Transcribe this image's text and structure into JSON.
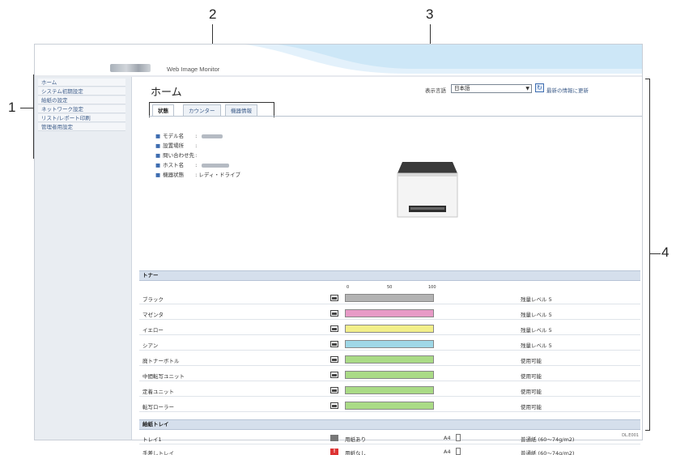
{
  "callouts": [
    "1",
    "2",
    "3",
    "4"
  ],
  "header": {
    "app_title": "Web Image Monitor"
  },
  "sidebar": {
    "items": [
      {
        "label": "ホーム"
      },
      {
        "label": "システム初期設定"
      },
      {
        "label": "給紙の設定"
      },
      {
        "label": "ネットワーク設定"
      },
      {
        "label": "リスト/レポート印刷"
      },
      {
        "label": "管理者用設定"
      }
    ]
  },
  "main": {
    "title": "ホーム",
    "language": {
      "label": "表示言語",
      "value": "日本語"
    },
    "refresh_label": "最新の情報に更新",
    "tabs": [
      {
        "label": "状態",
        "active": true
      },
      {
        "label": "カウンター",
        "active": false
      },
      {
        "label": "機器情報",
        "active": false
      }
    ],
    "info": [
      {
        "label": "モデル名",
        "value": ":"
      },
      {
        "label": "設置場所",
        "value": ":"
      },
      {
        "label": "問い合わせ先",
        "value": ":"
      },
      {
        "label": "ホスト名",
        "value": ":"
      },
      {
        "label": "機器状態",
        "value": ": レディ・ドライブ"
      }
    ]
  },
  "toner": {
    "section_label": "トナー",
    "scale": [
      "0",
      "50",
      "100"
    ],
    "rows": [
      {
        "name": "ブラック",
        "level": 1.0,
        "color": "#b3b3b3",
        "status": "残量レベル 5"
      },
      {
        "name": "マゼンタ",
        "level": 1.0,
        "color": "#e79ac6",
        "status": "残量レベル 5"
      },
      {
        "name": "イエロー",
        "level": 1.0,
        "color": "#f2ef8a",
        "status": "残量レベル 5"
      },
      {
        "name": "シアン",
        "level": 1.0,
        "color": "#9fd8e7",
        "status": "残量レベル 5"
      },
      {
        "name": "廃トナーボトル",
        "level": 1.0,
        "color": "#aadb86",
        "status": "使用可能"
      },
      {
        "name": "中間転写ユニット",
        "level": 1.0,
        "color": "#aadb86",
        "status": "使用可能"
      },
      {
        "name": "定着ユニット",
        "level": 1.0,
        "color": "#aadb86",
        "status": "使用可能"
      },
      {
        "name": "転写ローラー",
        "level": 1.0,
        "color": "#aadb86",
        "status": "使用可能"
      }
    ]
  },
  "trays": {
    "section_label": "給紙トレイ",
    "rows": [
      {
        "name": "トレイ1",
        "state": "用紙あり",
        "size": "A4",
        "type": "普通紙 (60〜74g/m2)",
        "empty": false
      },
      {
        "name": "手差しトレイ",
        "state": "用紙なし",
        "size": "A4",
        "type": "普通紙 (60〜74g/m2)",
        "empty": true
      }
    ]
  },
  "corner_code": "DL.E001"
}
